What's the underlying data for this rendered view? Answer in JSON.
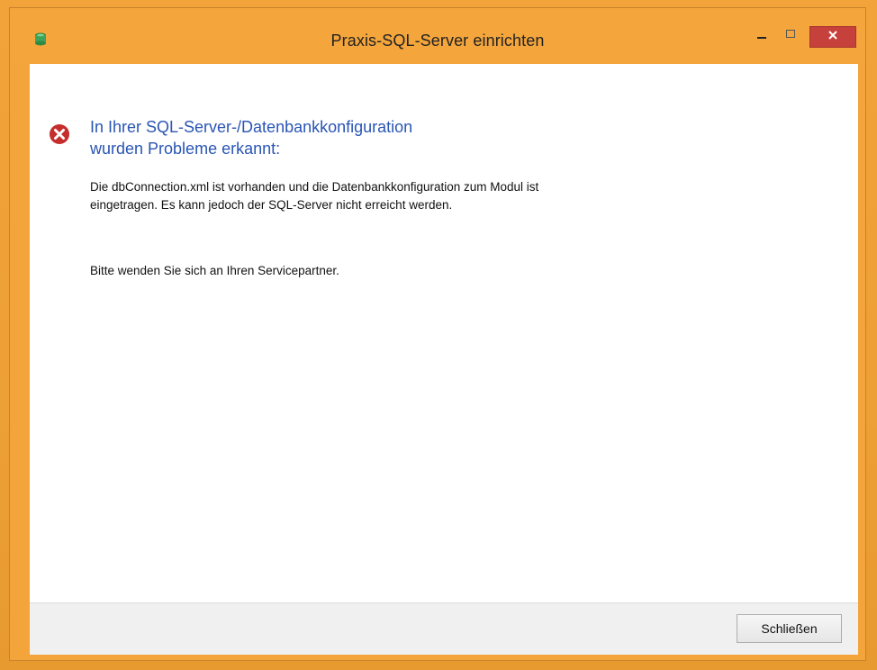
{
  "window": {
    "title": "Praxis-SQL-Server einrichten",
    "controls": {
      "minimize_icon": "minimize-icon",
      "maximize_icon": "maximize-icon",
      "close_icon": "close-icon",
      "close_color": "#c7413c"
    },
    "app_icon": "database-icon",
    "accent_color": "#f4a63c"
  },
  "message": {
    "icon": "error-icon",
    "icon_color": "#c62d2d",
    "heading_line1": "In Ihrer SQL-Server-/Datenbankkonfiguration",
    "heading_line2": "wurden Probleme erkannt:",
    "body_line1": "Die dbConnection.xml ist vorhanden und die Datenbankkonfiguration zum Modul ist",
    "body_line2": "eingetragen. Es kann jedoch der SQL-Server nicht erreicht werden.",
    "contact": "Bitte wenden Sie sich an Ihren Servicepartner.",
    "heading_color": "#2a55b4"
  },
  "footer": {
    "close_label": "Schließen"
  }
}
